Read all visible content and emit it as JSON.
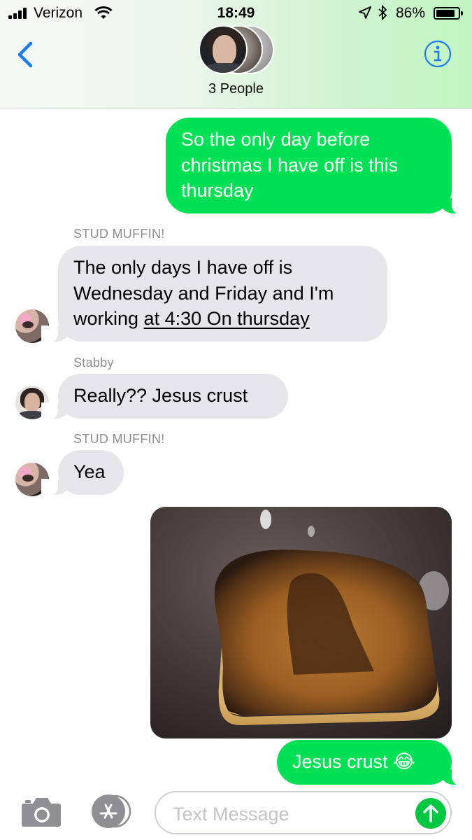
{
  "status_bar": {
    "carrier": "Verizon",
    "time": "18:49",
    "battery_percent": "86%",
    "battery_level": 0.86
  },
  "nav": {
    "back_icon": "chevron-left-icon",
    "info_icon": "info-icon",
    "group_label": "3 People"
  },
  "messages": [
    {
      "type": "sent",
      "text": "So the only day before christmas I have off is this thursday"
    },
    {
      "type": "received",
      "sender": "STUD MUFFIN!",
      "text_plain": "The only days I have off is Wednesday and Friday and I'm working ",
      "text_link": "at 4:30 On thursday"
    },
    {
      "type": "received",
      "sender": "Stabby",
      "text": "Really?? Jesus crust"
    },
    {
      "type": "received",
      "sender": "STUD MUFFIN!",
      "text": "Yea"
    },
    {
      "type": "sent_image",
      "image": "burnt-toast-photo"
    },
    {
      "type": "sent",
      "text": "Jesus crust 😂"
    }
  ],
  "input_bar": {
    "camera_icon": "camera-icon",
    "apps_icon": "app-store-icon",
    "placeholder": "Text Message",
    "send_icon": "arrow-up-icon"
  },
  "colors": {
    "sent_bubble": "#00e054",
    "received_bubble": "#e6e5ea",
    "accent": "#1a7cf0"
  }
}
